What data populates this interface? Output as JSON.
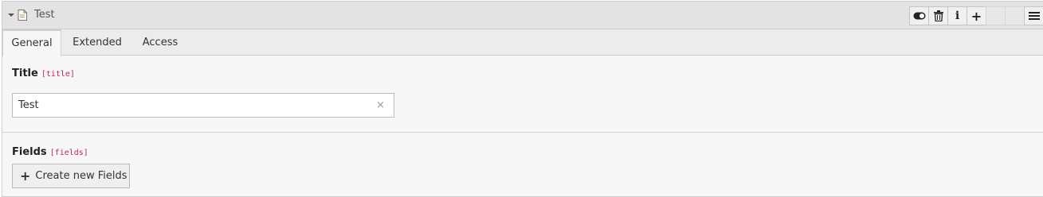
{
  "header": {
    "title": "Test",
    "actions": [
      {
        "name": "toggle-icon"
      },
      {
        "name": "trash-icon"
      },
      {
        "name": "info-icon",
        "glyph": "i"
      },
      {
        "name": "plus-icon",
        "glyph": "+"
      },
      {
        "name": "blank-1"
      },
      {
        "name": "blank-2"
      },
      {
        "name": "menu-icon"
      }
    ]
  },
  "tabs": [
    {
      "label": "General",
      "active": true
    },
    {
      "label": "Extended",
      "active": false
    },
    {
      "label": "Access",
      "active": false
    }
  ],
  "fields": {
    "title": {
      "label": "Title",
      "code": "[title]",
      "value": "Test",
      "clear_glyph": "×"
    },
    "fields": {
      "label": "Fields",
      "code": "[fields]",
      "button_label": "Create new Fields",
      "button_glyph": "+"
    }
  },
  "colors": {
    "code_color": "#c7254e",
    "header_bg": "#e3e3e3",
    "panel_bg": "#f7f7f7"
  }
}
